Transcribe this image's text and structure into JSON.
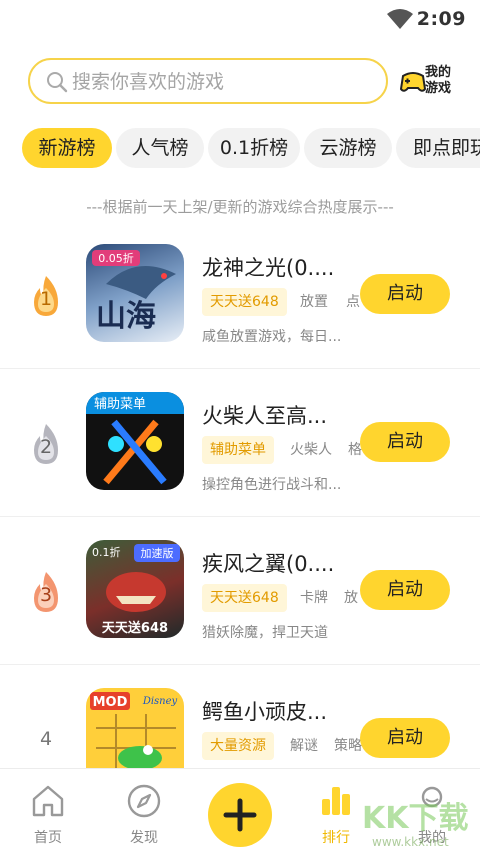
{
  "status_bar": {
    "time": "2:09"
  },
  "search": {
    "placeholder": "搜索你喜欢的游戏"
  },
  "my_games": {
    "line1": "我的",
    "line2": "游戏"
  },
  "tabs": [
    {
      "label": "新游榜"
    },
    {
      "label": "人气榜"
    },
    {
      "label": "0.1折榜"
    },
    {
      "label": "云游榜"
    },
    {
      "label": "即点即玩"
    }
  ],
  "subtitle": "---根据前一天上架/更新的游戏综合热度展示---",
  "games": [
    {
      "rank": "1",
      "title": "龙神之光(0....",
      "tag_primary": "天天送648",
      "tags": [
        "放置",
        "点"
      ],
      "description": "咸鱼放置游戏，每日...",
      "button": "启动",
      "icon_text": "山海",
      "icon_badge": "0.05折"
    },
    {
      "rank": "2",
      "title": "火柴人至高...",
      "tag_primary": "辅助菜单",
      "tags": [
        "火柴人",
        "格"
      ],
      "description": "操控角色进行战斗和...",
      "button": "启动",
      "icon_text": "辅助菜单"
    },
    {
      "rank": "3",
      "title": "疾风之翼(0....",
      "tag_primary": "天天送648",
      "tags": [
        "卡牌",
        "放"
      ],
      "description": "猎妖除魔，捍卫天道",
      "button": "启动",
      "icon_text": "天天送648",
      "icon_badge": "加速版",
      "icon_badge2": "0.1折"
    },
    {
      "rank": "4",
      "title": "鳄鱼小顽皮...",
      "tag_primary": "大量资源",
      "tags": [
        "解谜",
        "策略"
      ],
      "description": "",
      "button": "启动",
      "icon_text": "MOD",
      "icon_badge": "Disney"
    }
  ],
  "bottom_nav": [
    {
      "label": "首页"
    },
    {
      "label": "发现"
    },
    {
      "label": "排行"
    },
    {
      "label": "我的"
    }
  ],
  "watermark": {
    "text": "KK下载",
    "url": "www.kkx.net"
  },
  "colors": {
    "accent": "#ffd52e",
    "accent_text": "#f0b800",
    "tag_bg": "#fff6d8",
    "tag_text": "#e29b00"
  }
}
